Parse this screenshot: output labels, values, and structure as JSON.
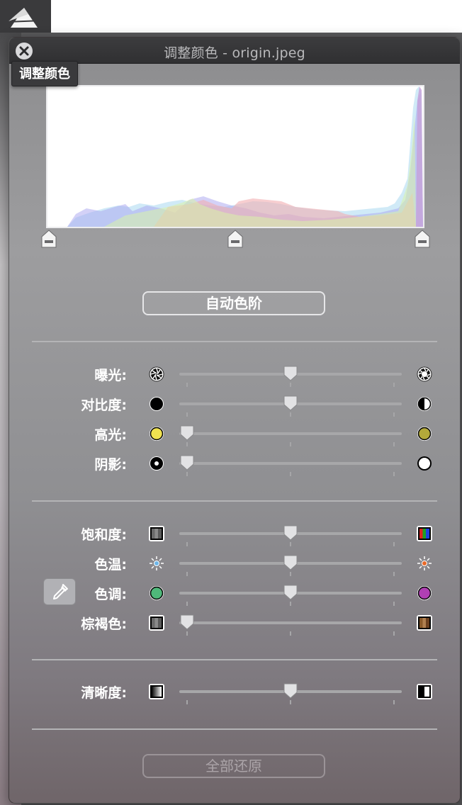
{
  "window": {
    "title": "调整颜色 - origin.jpeg",
    "tooltip": "调整颜色"
  },
  "levels": {
    "black_point": 0.0,
    "midtone": 0.5,
    "white_point": 1.0
  },
  "auto_levels_label": "自动色阶",
  "reset_all_label": "全部还原",
  "sliders": [
    {
      "key": "exposure",
      "label": "曝光:",
      "value": 0.5,
      "left_icon": "aperture-small-icon",
      "right_icon": "aperture-large-icon",
      "group": 1
    },
    {
      "key": "contrast",
      "label": "对比度:",
      "value": 0.5,
      "left_icon": "black-circle-icon",
      "right_icon": "half-circle-icon",
      "group": 1
    },
    {
      "key": "highlights",
      "label": "高光:",
      "value": 0.0,
      "left_icon": "yellow-circle-icon",
      "right_icon": "olive-circle-icon",
      "group": 1
    },
    {
      "key": "shadows",
      "label": "阴影:",
      "value": 0.0,
      "left_icon": "dot-circle-icon",
      "right_icon": "white-circle-icon",
      "group": 1
    },
    {
      "key": "saturation",
      "label": "饱和度:",
      "value": 0.5,
      "left_icon": "gray-stripes-icon",
      "right_icon": "color-stripes-icon",
      "group": 2
    },
    {
      "key": "temperature",
      "label": "色温:",
      "value": 0.5,
      "left_icon": "cool-sun-icon",
      "right_icon": "warm-sun-icon",
      "group": 2
    },
    {
      "key": "tint",
      "label": "色调:",
      "value": 0.5,
      "left_icon": "green-circle-icon",
      "right_icon": "magenta-circle-icon",
      "group": 2
    },
    {
      "key": "sepia",
      "label": "棕褐色:",
      "value": 0.0,
      "left_icon": "gray-stripes-icon",
      "right_icon": "sepia-stripes-icon",
      "group": 2
    },
    {
      "key": "sharpness",
      "label": "清晰度:",
      "value": 0.5,
      "left_icon": "blur-square-icon",
      "right_icon": "sharp-square-icon",
      "group": 3
    }
  ],
  "colors": {
    "panel_title_text": "#b9b9bb",
    "label_text": "#ffffff",
    "highlight_yellow": "#f0e250",
    "highlight_olive": "#b3a93a",
    "tint_green": "#4fb87a",
    "tint_magenta": "#b03fb3"
  }
}
